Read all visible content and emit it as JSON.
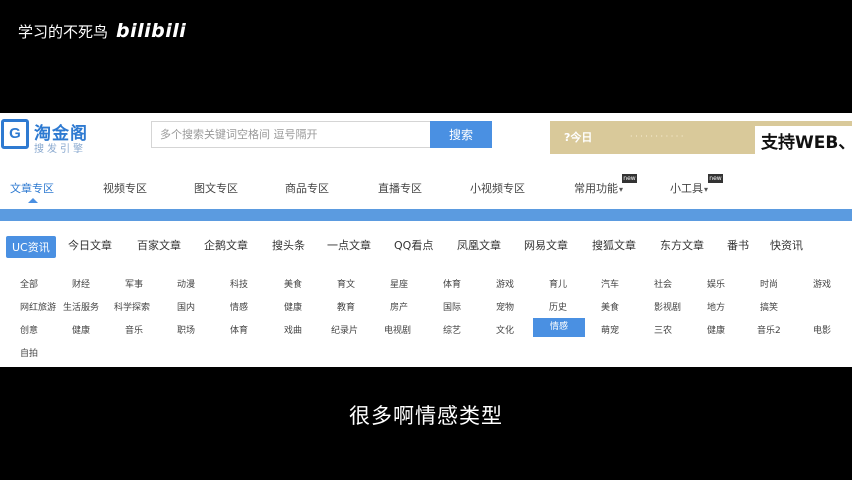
{
  "video": {
    "channel": "学习的不死鸟",
    "logo": "bilibili",
    "subtitle": "很多啊情感类型"
  },
  "header": {
    "brand_name": "淘金阁",
    "brand_tag": "搜发引擎",
    "search_placeholder": "多个搜索关键词空格间 逗号隔开",
    "search_button": "搜索",
    "banner_left": "?今日",
    "banner_mid": "· · · · · · · · · · ·",
    "banner_right": "支持WEB、PC"
  },
  "topnav": {
    "items": [
      "文章专区",
      "视频专区",
      "图文专区",
      "商品专区",
      "直播专区",
      "小视频专区",
      "常用功能",
      "小工具"
    ],
    "hot_badge": "new",
    "caret": "▾"
  },
  "platforms": {
    "tabs": [
      "UC资讯",
      "今日文章",
      "百家文章",
      "企鹅文章",
      "搜头条",
      "一点文章",
      "QQ看点",
      "凤凰文章",
      "网易文章",
      "搜狐文章",
      "东方文章",
      "番书",
      "快资讯"
    ]
  },
  "categories": {
    "rows": [
      [
        "全部",
        "财经",
        "军事",
        "动漫",
        "科技",
        "美食",
        "育文",
        "星座",
        "体育",
        "游戏",
        "育儿",
        "汽车",
        "社会",
        "娱乐",
        "时尚",
        "游戏"
      ],
      [
        "网红旅游",
        "生活服务",
        "科学探索",
        "国内",
        "情感",
        "健康",
        "教育",
        "房产",
        "国际",
        "宠物",
        "历史",
        "美食",
        "影视剧",
        "地方",
        "搞笑"
      ],
      [
        "创意",
        "健康",
        "音乐",
        "职场",
        "体育",
        "戏曲",
        "纪录片",
        "电视剧",
        "综艺",
        "文化",
        "情感",
        "萌宠",
        "三农",
        "健康",
        "音乐2",
        "电影"
      ],
      [
        "自拍"
      ]
    ],
    "active": "情感"
  }
}
